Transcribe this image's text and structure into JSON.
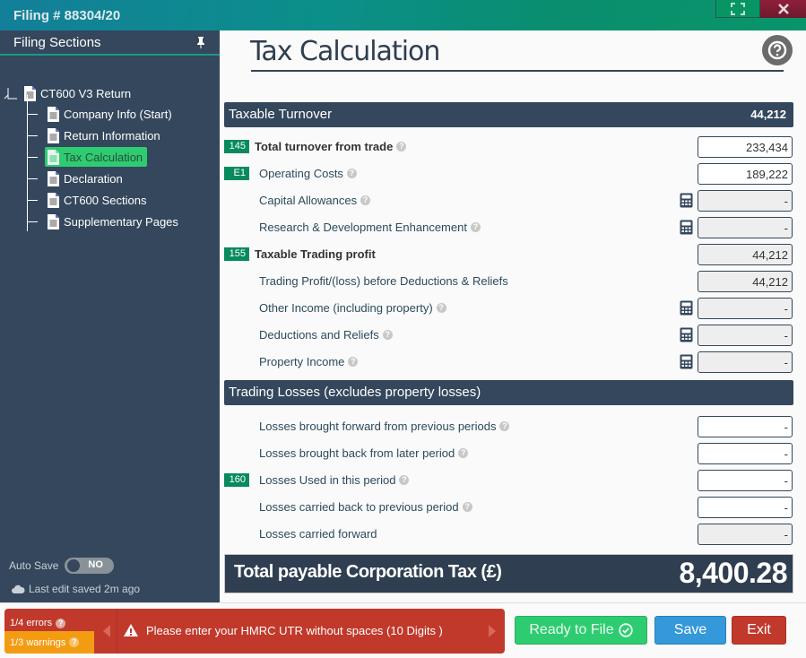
{
  "window": {
    "title": "Filing # 88304/20",
    "maximize_icon": "maximize-icon",
    "close_icon": "close-icon"
  },
  "sidebar": {
    "header": "Filing Sections",
    "pin_icon": "pin-icon",
    "collapse_label": "»",
    "tree": {
      "root": "CT600 V3 Return",
      "items": [
        {
          "label": "Company Info (Start)",
          "active": false
        },
        {
          "label": "Return Information",
          "active": false
        },
        {
          "label": "Tax Calculation",
          "active": true
        },
        {
          "label": "Declaration",
          "active": false
        },
        {
          "label": "CT600 Sections",
          "active": false
        },
        {
          "label": "Supplementary Pages",
          "active": false
        }
      ]
    },
    "autosave": {
      "label": "Auto Save",
      "state": "NO"
    },
    "last_saved": "Last edit saved 2m ago"
  },
  "main": {
    "title": "Tax Calculation",
    "help_icon": "help-icon",
    "sections": [
      {
        "title": "Taxable Turnover",
        "value": "44,212",
        "rows": [
          {
            "badge": "145",
            "label": "Total turnover from trade",
            "bold": true,
            "help": true,
            "calc": false,
            "value": "233,434",
            "readonly": false
          },
          {
            "badge": "E1",
            "label": "Operating Costs",
            "bold": false,
            "help": true,
            "calc": false,
            "value": "189,222",
            "readonly": false
          },
          {
            "badge": "",
            "label": "Capital Allowances",
            "bold": false,
            "help": true,
            "calc": true,
            "value": "-",
            "readonly": true
          },
          {
            "badge": "",
            "label": "Research & Development Enhancement",
            "bold": false,
            "help": true,
            "calc": true,
            "value": "-",
            "readonly": true
          },
          {
            "badge": "155",
            "label": "Taxable Trading profit",
            "bold": true,
            "help": false,
            "calc": false,
            "value": "44,212",
            "readonly": true
          },
          {
            "badge": "",
            "label": "Trading Profit/(loss) before Deductions & Reliefs",
            "bold": false,
            "help": false,
            "calc": false,
            "value": "44,212",
            "readonly": true
          },
          {
            "badge": "",
            "label": "Other Income (including property)",
            "bold": false,
            "help": true,
            "calc": true,
            "value": "-",
            "readonly": true
          },
          {
            "badge": "",
            "label": "Deductions and Reliefs",
            "bold": false,
            "help": true,
            "calc": true,
            "value": "-",
            "readonly": true
          },
          {
            "badge": "",
            "label": "Property Income",
            "bold": false,
            "help": true,
            "calc": true,
            "value": "-",
            "readonly": true
          }
        ]
      },
      {
        "title": "Trading Losses (excludes property losses)",
        "value": "",
        "rows": [
          {
            "badge": "",
            "label": "Losses brought forward from previous periods",
            "bold": false,
            "help": true,
            "calc": false,
            "value": "-",
            "readonly": false
          },
          {
            "badge": "",
            "label": "Losses brought back from later period",
            "bold": false,
            "help": true,
            "calc": false,
            "value": "-",
            "readonly": false
          },
          {
            "badge": "160",
            "label": "Losses Used in this period",
            "bold": false,
            "help": true,
            "calc": false,
            "value": "-",
            "readonly": false
          },
          {
            "badge": "",
            "label": "Losses carried back to previous period",
            "bold": false,
            "help": true,
            "calc": false,
            "value": "-",
            "readonly": false
          },
          {
            "badge": "",
            "label": "Losses carried forward",
            "bold": false,
            "help": false,
            "calc": false,
            "value": "-",
            "readonly": true
          }
        ]
      }
    ],
    "total": {
      "label": "Total payable Corporation Tax (£)",
      "value": "8,400.28"
    }
  },
  "footer": {
    "errors": "1/4 errors",
    "warnings": "1/3 warnings",
    "message": "Please enter your HMRC UTR without spaces (10 Digits )",
    "buttons": {
      "ready": "Ready to File",
      "save": "Save",
      "exit": "Exit"
    }
  },
  "colors": {
    "sidebar_bg": "#34475c",
    "active_item": "#2ecc71",
    "badge": "#078a5e",
    "error": "#c0392b",
    "warning": "#f39c12",
    "save": "#3498db"
  }
}
